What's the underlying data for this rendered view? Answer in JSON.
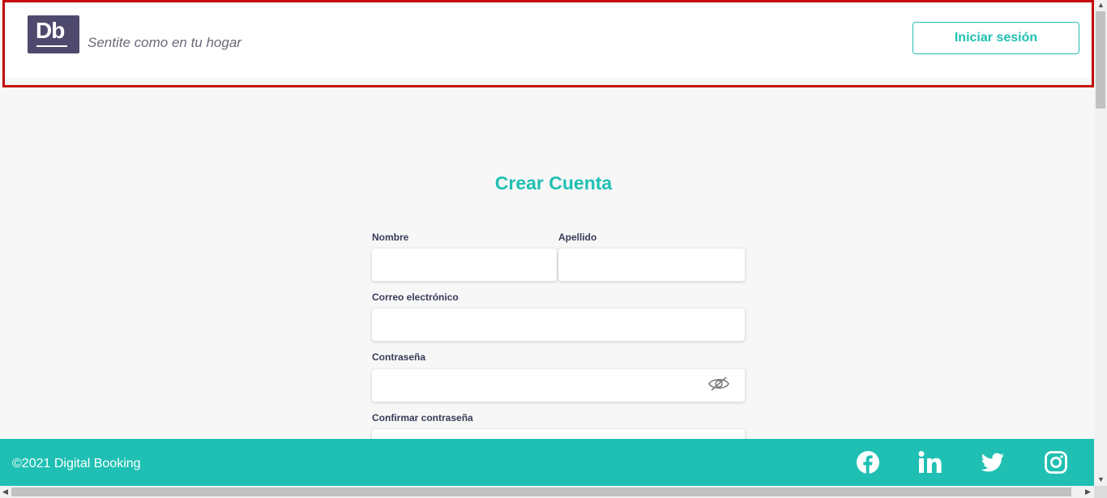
{
  "header": {
    "logo_text": "Db",
    "tagline": "Sentite como en tu hogar",
    "login_label": "Iniciar sesión"
  },
  "form": {
    "title": "Crear Cuenta",
    "first_name_label": "Nombre",
    "first_name_value": "",
    "last_name_label": "Apellido",
    "last_name_value": "",
    "email_label": "Correo electrónico",
    "email_value": "",
    "password_label": "Contraseña",
    "password_value": "",
    "confirm_password_label": "Confirmar contraseña",
    "confirm_password_value": ""
  },
  "footer": {
    "copyright": "©2021 Digital Booking",
    "social_icons": [
      "facebook-icon",
      "linkedin-icon",
      "twitter-icon",
      "instagram-icon"
    ]
  },
  "colors": {
    "accent": "#1fc0b3",
    "brand": "#4e4a6e",
    "header_highlight": "#c40a0a",
    "label_text": "#383b58"
  }
}
